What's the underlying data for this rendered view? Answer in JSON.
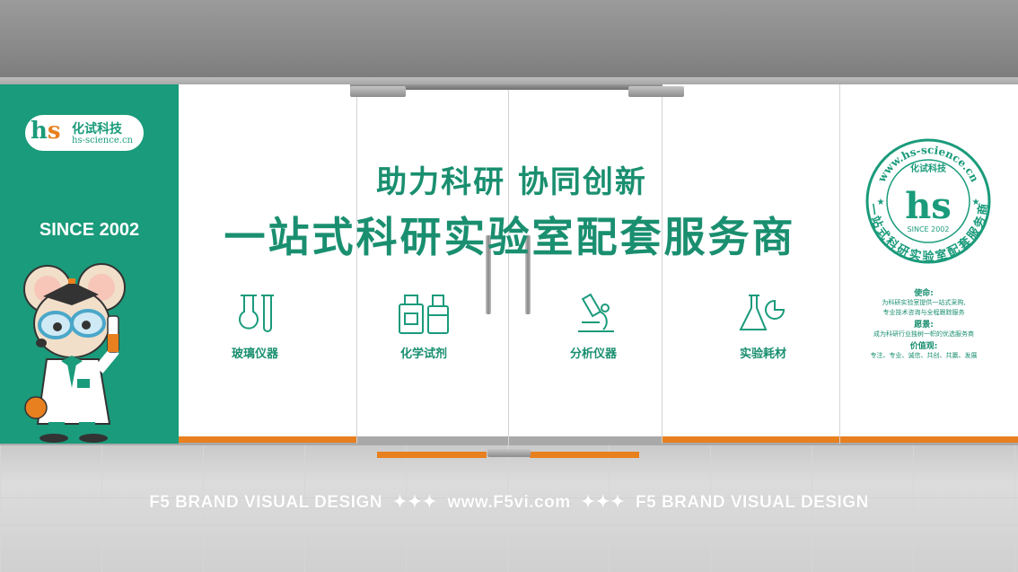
{
  "logo": {
    "mark": "hs",
    "name": "化试科技",
    "url": "hs-science.cn"
  },
  "since": "SINCE 2002",
  "slogan": {
    "line1": "助力科研  协同创新",
    "line2": "一站式科研实验室配套服务商"
  },
  "categories": [
    {
      "label": "玻璃仪器",
      "icon": "glassware-icon"
    },
    {
      "label": "化学试剂",
      "icon": "reagent-bottles-icon"
    },
    {
      "label": "分析仪器",
      "icon": "microscope-icon"
    },
    {
      "label": "实验耗材",
      "icon": "flask-consumables-icon"
    }
  ],
  "seal": {
    "url_arc": "www.hs-science.cn",
    "name": "化试科技",
    "mark": "hs",
    "since": "SINCE 2002",
    "slogan_arc": "一站式科研实验室配套服务商"
  },
  "info": {
    "mission_title": "使命:",
    "mission_line1": "为科研实验室提供一站式采购,",
    "mission_line2": "专业技术咨询与全程跟踪服务",
    "vision_title": "愿景:",
    "vision_line1": "成为科研行业独树一帜的优选服务商",
    "values_title": "价值观:",
    "values_line1": "专注、专业、诚信、共创、共赢、发展"
  },
  "watermark": "F5 BRAND VISUAL DESIGN  ✦✦✦  www.F5vi.com  ✦✦✦  F5 BRAND VISUAL DESIGN",
  "colors": {
    "brand_green": "#1a9b7b",
    "accent_orange": "#e8801f"
  }
}
